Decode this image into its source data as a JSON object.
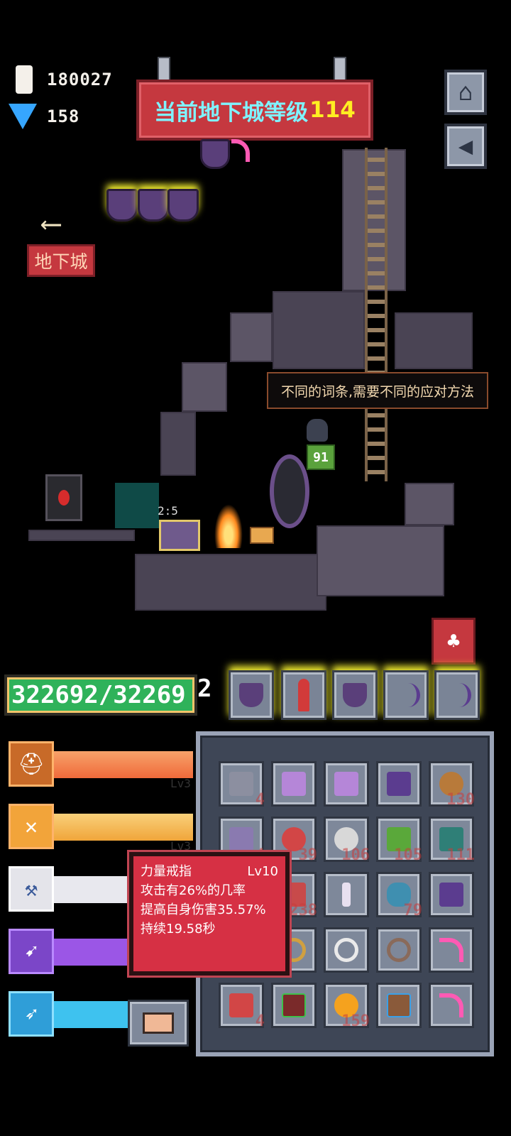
{
  "currency": {
    "crystal_icon": "white-crystal",
    "crystal_value": "180027",
    "gem_icon": "blue-diamond",
    "gem_value": "158"
  },
  "banner": {
    "title": "当前地下城等级",
    "level": "114"
  },
  "buttons": {
    "home_icon": "home-icon",
    "sound_icon": "speaker-icon",
    "dungeon_label": "地下城"
  },
  "scene": {
    "hint_text": "不同的词条,需要不同的应对方法",
    "enemy_level": "91",
    "chest_timer": "2:5"
  },
  "player": {
    "hp_text": "322692/32269",
    "hp_overflow": "2",
    "hp_fraction": 1.0
  },
  "equipped": [
    {
      "icon": "shield-icon"
    },
    {
      "icon": "rocket-icon"
    },
    {
      "icon": "shield-icon"
    },
    {
      "icon": "bow-icon"
    },
    {
      "icon": "bow-icon"
    }
  ],
  "skills": [
    {
      "icon": "helmet-icon",
      "level": "Lv3",
      "color": "#f06a3a"
    },
    {
      "icon": "crossed-feathers-icon",
      "level": "Lv3",
      "color": "#f0a53a"
    },
    {
      "icon": "axe-icon",
      "level": "",
      "color": "#e8e8ee"
    },
    {
      "icon": "arrows-icon",
      "level": "",
      "color": "#9b56e6"
    },
    {
      "icon": "bow-icon",
      "level": "",
      "color": "#3ec2ef"
    }
  ],
  "inventory": [
    {
      "icon": "scroll-icon",
      "count": "4"
    },
    {
      "icon": "hammer-icon",
      "count": ""
    },
    {
      "icon": "hammer-icon",
      "count": ""
    },
    {
      "icon": "bow-icon",
      "count": ""
    },
    {
      "icon": "gourd-icon",
      "count": "130"
    },
    {
      "icon": "scroll-icon",
      "count": "4"
    },
    {
      "icon": "potion-icon",
      "count": "39"
    },
    {
      "icon": "flask-icon",
      "count": "106"
    },
    {
      "icon": "jar-icon",
      "count": "105"
    },
    {
      "icon": "bottle-icon",
      "count": "111"
    },
    {
      "icon": "pouch-icon",
      "count": "238"
    },
    {
      "icon": "staff-icon",
      "count": ""
    },
    {
      "icon": "vase-icon",
      "count": "79"
    },
    {
      "icon": "bow-icon",
      "count": ""
    },
    {
      "icon": "ring-icon",
      "count": ""
    },
    {
      "icon": "ring-icon",
      "count": ""
    },
    {
      "icon": "ring-icon",
      "count": ""
    },
    {
      "icon": "scythe-icon",
      "count": ""
    },
    {
      "icon": "scroll-icon",
      "count": "4"
    },
    {
      "icon": "book-icon",
      "count": ""
    },
    {
      "icon": "orb-icon",
      "count": "159"
    },
    {
      "icon": "book-icon",
      "count": ""
    },
    {
      "icon": "scythe-icon",
      "count": ""
    }
  ],
  "tooltip": {
    "name": "力量戒指",
    "level": "Lv10",
    "line1": "攻击有26%的几率",
    "line2": "提高自身伤害35.57%",
    "line3": "持续19.58秒"
  },
  "colors": {
    "banner_red": "#c5383f",
    "banner_text": "#7ff3ff",
    "level_yellow": "#ffee22",
    "hp_green": "#2fb25a"
  }
}
